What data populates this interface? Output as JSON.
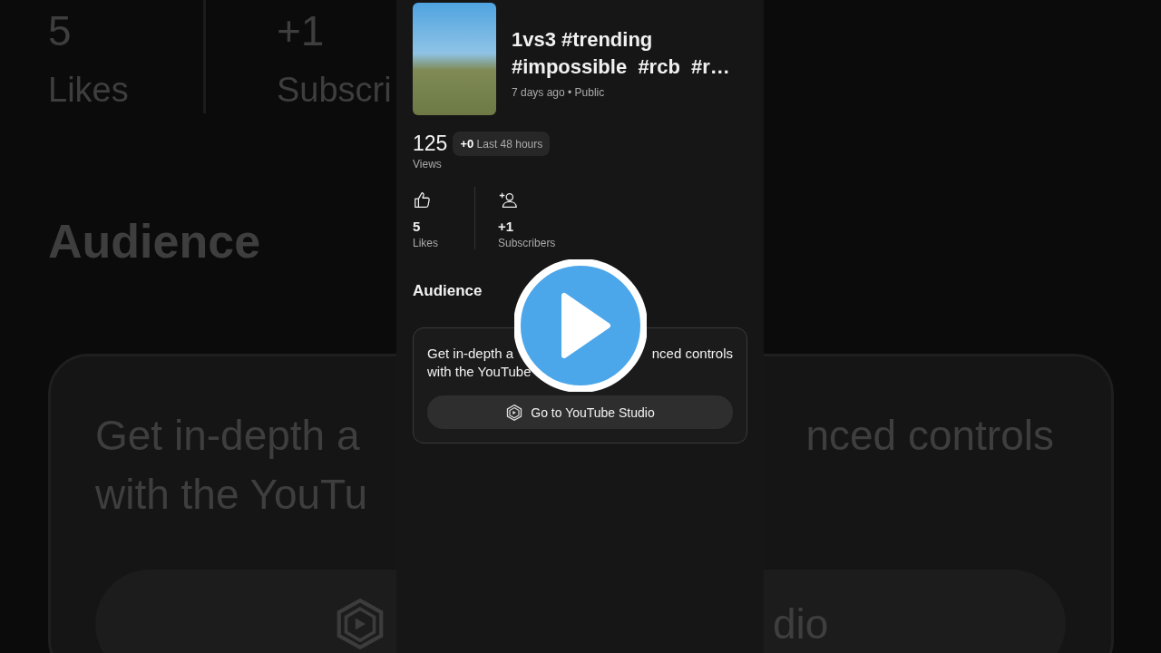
{
  "background": {
    "likes_value": "5",
    "likes_label": "Likes",
    "subscribers_value": "+1",
    "subscribers_label": "Subscri",
    "section_title": "Audience",
    "card_line_1_left": "Get in-depth a",
    "card_line_1_right": "nced controls",
    "card_line_2": "with the YouTu",
    "button_fragment": "dio"
  },
  "video": {
    "title_lines": [
      "1vs3 #trending",
      "#impossible  #rcb  #r…"
    ],
    "meta": "7 days ago • Public"
  },
  "views": {
    "value": "125",
    "delta": "+0",
    "period": "Last 48 hours",
    "label": "Views"
  },
  "stats": [
    {
      "kind": "likes",
      "value": "5",
      "label": "Likes"
    },
    {
      "kind": "subscribers",
      "value": "+1",
      "label": "Subscribers"
    }
  ],
  "audience": {
    "title": "Audience",
    "card_line_1": [
      "Get in-depth a",
      "nced controls"
    ],
    "card_line_2": "with the YouTube",
    "button": "Go to YouTube Studio"
  }
}
